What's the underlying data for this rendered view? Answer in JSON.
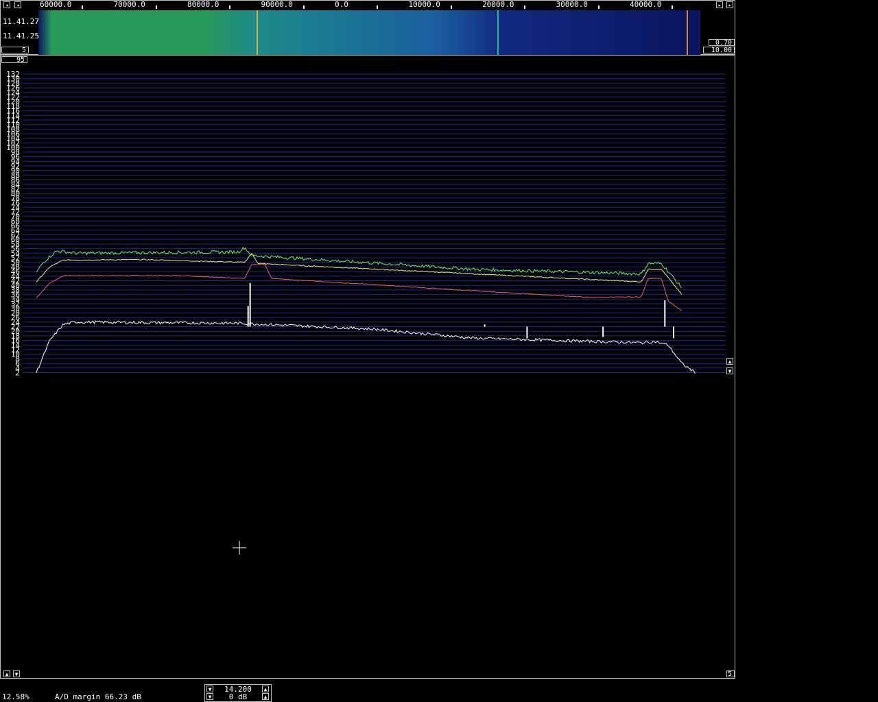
{
  "waterfall": {
    "freq_labels": [
      "60000.0",
      "70000.0",
      "80000.0",
      "90000.0",
      "0.0",
      "10000.0",
      "20000.0",
      "30000.0",
      "40000.0"
    ],
    "times": [
      "11.41.27",
      "11.41.25"
    ],
    "avg_box": "5",
    "gain_box": "0.70",
    "zero_box": "10.00",
    "scroll_left_icon": "left-arrow",
    "scroll_right_icon": "right-arrow",
    "colors": {
      "low": "#0a1460",
      "mid": "#1b6fa0",
      "high": "#2a9a5a"
    }
  },
  "spectrum": {
    "top_box": "95",
    "bottom_right_box": "5",
    "y_labels": [
      "132",
      "130",
      "128",
      "126",
      "124",
      "122",
      "120",
      "118",
      "116",
      "114",
      "112",
      "110",
      "108",
      "106",
      "104",
      "102",
      "100",
      "98",
      "96",
      "94",
      "92",
      "90",
      "88",
      "86",
      "84",
      "82",
      "80",
      "78",
      "76",
      "74",
      "72",
      "70",
      "68",
      "66",
      "64",
      "62",
      "60",
      "58",
      "56",
      "54",
      "52",
      "50",
      "48",
      "46",
      "44",
      "42",
      "40",
      "38",
      "36",
      "34",
      "32",
      "30",
      "28",
      "26",
      "24",
      "22",
      "20",
      "18",
      "16",
      "14",
      "12",
      "10",
      "8",
      "6",
      "4",
      "2"
    ],
    "colors": {
      "grid": "#1a2a9a",
      "green": "#6cf06c",
      "yellow": "#f0f070",
      "red": "#f06060",
      "white": "#ffffff"
    },
    "traces": {
      "green": [
        [
          0.0,
          45.5
        ],
        [
          0.01,
          50
        ],
        [
          0.03,
          55
        ],
        [
          0.06,
          54
        ],
        [
          0.3,
          54.5
        ],
        [
          0.31,
          56.5
        ],
        [
          0.32,
          53
        ],
        [
          0.65,
          47
        ],
        [
          0.9,
          45
        ],
        [
          0.91,
          49.5
        ],
        [
          0.93,
          49.5
        ],
        [
          0.96,
          39
        ]
      ],
      "yellow": [
        [
          0.0,
          41.5
        ],
        [
          0.02,
          48
        ],
        [
          0.04,
          51
        ],
        [
          0.16,
          51.2
        ],
        [
          0.31,
          50
        ],
        [
          0.32,
          54
        ],
        [
          0.33,
          49.5
        ],
        [
          0.65,
          45
        ],
        [
          0.9,
          41.5
        ],
        [
          0.91,
          47
        ],
        [
          0.93,
          47
        ],
        [
          0.96,
          36
        ]
      ],
      "red": [
        [
          0.0,
          34.5
        ],
        [
          0.02,
          41
        ],
        [
          0.04,
          44.2
        ],
        [
          0.22,
          44.2
        ],
        [
          0.31,
          43
        ],
        [
          0.32,
          49
        ],
        [
          0.34,
          49
        ],
        [
          0.35,
          43
        ],
        [
          0.63,
          38
        ],
        [
          0.82,
          34.8
        ],
        [
          0.9,
          35
        ],
        [
          0.91,
          43
        ],
        [
          0.93,
          43
        ],
        [
          0.94,
          33
        ],
        [
          0.96,
          29
        ]
      ],
      "white": [
        [
          0.0,
          2
        ],
        [
          0.02,
          16
        ],
        [
          0.04,
          23
        ],
        [
          0.06,
          24
        ],
        [
          0.3,
          23.5
        ],
        [
          0.5,
          21
        ],
        [
          0.65,
          17
        ],
        [
          0.9,
          15
        ],
        [
          0.92,
          15.5
        ],
        [
          0.94,
          14
        ],
        [
          0.96,
          6
        ],
        [
          0.98,
          2
        ]
      ]
    },
    "spikes": [
      [
        0.318,
        41
      ],
      [
        0.315,
        31
      ],
      [
        0.667,
        23
      ],
      [
        0.73,
        17
      ],
      [
        0.843,
        17.5
      ],
      [
        0.935,
        33.5
      ],
      [
        0.948,
        17
      ]
    ]
  },
  "status": {
    "cpu": "12.58%",
    "ad_margin": "A/D margin 66.23 dB",
    "freq_value": "14.200",
    "gain_value": "0 dB"
  }
}
